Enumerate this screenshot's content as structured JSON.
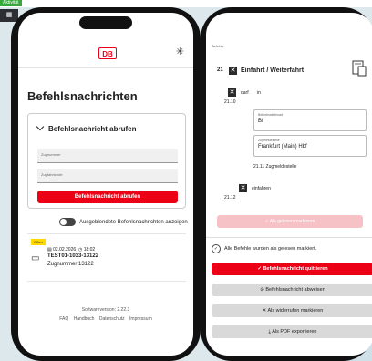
{
  "background": {
    "chip_label": "Aktivität",
    "dark_tile_icon": "grid-icon"
  },
  "left": {
    "logo": "DB",
    "page_title": "Befehlsnachrichten",
    "card": {
      "title": "Befehlsnachricht abrufen",
      "field1_placeholder": "Zugnummer",
      "field2_placeholder": "Zugfahrtcode",
      "button": "Befehlsnachricht abrufen"
    },
    "toggle_label": "Ausgeblendete Befehlsnachrichten anzeigen",
    "message": {
      "badge": "Offen",
      "date": "02.02.2026",
      "time": "18:02",
      "id": "TEST01-1033-13122",
      "zugnummer": "Zugnummer 13122"
    },
    "footer": {
      "version": "Softwareversion: 2.22.3",
      "links": [
        "FAQ",
        "Handbuch",
        "Datenschutz",
        "Impressum"
      ]
    }
  },
  "right": {
    "screen_label": "Befehle",
    "section_number": "21",
    "section_title": "Einfahrt / Weiterfahrt",
    "row1_text": "darf",
    "row1_text2": "in",
    "row1_num": "21.10",
    "field1": {
      "label": "Betriebsstellenart",
      "value": "Bf"
    },
    "field2": {
      "label": "Zugmeldestelle",
      "value": "Frankfurt (Main) Hbf"
    },
    "row_2111": "21.11 Zugmeldestelle",
    "row2_text": "einfahren",
    "row2_num": "21.12",
    "disabled_button": "Als gelesen markieren",
    "all_read": "Alle Befehle wurden als gelesen markiert.",
    "actions": [
      "Befehlsnachricht quittieren",
      "Befehlsnachricht abweisen",
      "Als widerrufen markieren",
      "Als PDF exportieren"
    ]
  },
  "colors": {
    "db_red": "#ec0016",
    "badge_yellow": "#ffd800"
  }
}
